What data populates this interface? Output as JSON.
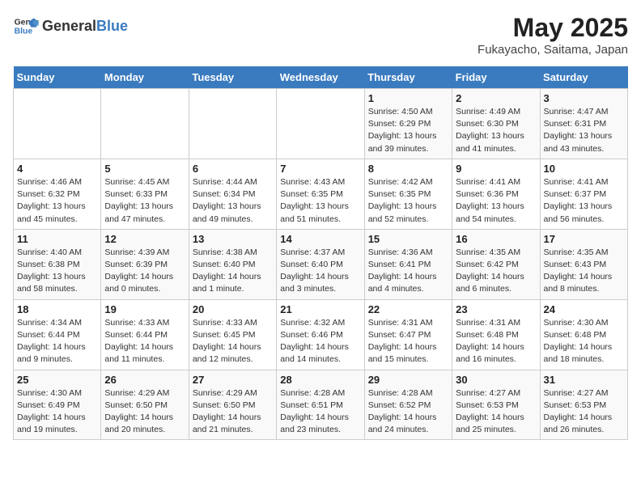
{
  "header": {
    "logo_general": "General",
    "logo_blue": "Blue",
    "title": "May 2025",
    "subtitle": "Fukayacho, Saitama, Japan"
  },
  "calendar": {
    "weekdays": [
      "Sunday",
      "Monday",
      "Tuesday",
      "Wednesday",
      "Thursday",
      "Friday",
      "Saturday"
    ],
    "rows": [
      [
        {
          "day": "",
          "info": ""
        },
        {
          "day": "",
          "info": ""
        },
        {
          "day": "",
          "info": ""
        },
        {
          "day": "",
          "info": ""
        },
        {
          "day": "1",
          "info": "Sunrise: 4:50 AM\nSunset: 6:29 PM\nDaylight: 13 hours\nand 39 minutes."
        },
        {
          "day": "2",
          "info": "Sunrise: 4:49 AM\nSunset: 6:30 PM\nDaylight: 13 hours\nand 41 minutes."
        },
        {
          "day": "3",
          "info": "Sunrise: 4:47 AM\nSunset: 6:31 PM\nDaylight: 13 hours\nand 43 minutes."
        }
      ],
      [
        {
          "day": "4",
          "info": "Sunrise: 4:46 AM\nSunset: 6:32 PM\nDaylight: 13 hours\nand 45 minutes."
        },
        {
          "day": "5",
          "info": "Sunrise: 4:45 AM\nSunset: 6:33 PM\nDaylight: 13 hours\nand 47 minutes."
        },
        {
          "day": "6",
          "info": "Sunrise: 4:44 AM\nSunset: 6:34 PM\nDaylight: 13 hours\nand 49 minutes."
        },
        {
          "day": "7",
          "info": "Sunrise: 4:43 AM\nSunset: 6:35 PM\nDaylight: 13 hours\nand 51 minutes."
        },
        {
          "day": "8",
          "info": "Sunrise: 4:42 AM\nSunset: 6:35 PM\nDaylight: 13 hours\nand 52 minutes."
        },
        {
          "day": "9",
          "info": "Sunrise: 4:41 AM\nSunset: 6:36 PM\nDaylight: 13 hours\nand 54 minutes."
        },
        {
          "day": "10",
          "info": "Sunrise: 4:41 AM\nSunset: 6:37 PM\nDaylight: 13 hours\nand 56 minutes."
        }
      ],
      [
        {
          "day": "11",
          "info": "Sunrise: 4:40 AM\nSunset: 6:38 PM\nDaylight: 13 hours\nand 58 minutes."
        },
        {
          "day": "12",
          "info": "Sunrise: 4:39 AM\nSunset: 6:39 PM\nDaylight: 14 hours\nand 0 minutes."
        },
        {
          "day": "13",
          "info": "Sunrise: 4:38 AM\nSunset: 6:40 PM\nDaylight: 14 hours\nand 1 minute."
        },
        {
          "day": "14",
          "info": "Sunrise: 4:37 AM\nSunset: 6:40 PM\nDaylight: 14 hours\nand 3 minutes."
        },
        {
          "day": "15",
          "info": "Sunrise: 4:36 AM\nSunset: 6:41 PM\nDaylight: 14 hours\nand 4 minutes."
        },
        {
          "day": "16",
          "info": "Sunrise: 4:35 AM\nSunset: 6:42 PM\nDaylight: 14 hours\nand 6 minutes."
        },
        {
          "day": "17",
          "info": "Sunrise: 4:35 AM\nSunset: 6:43 PM\nDaylight: 14 hours\nand 8 minutes."
        }
      ],
      [
        {
          "day": "18",
          "info": "Sunrise: 4:34 AM\nSunset: 6:44 PM\nDaylight: 14 hours\nand 9 minutes."
        },
        {
          "day": "19",
          "info": "Sunrise: 4:33 AM\nSunset: 6:44 PM\nDaylight: 14 hours\nand 11 minutes."
        },
        {
          "day": "20",
          "info": "Sunrise: 4:33 AM\nSunset: 6:45 PM\nDaylight: 14 hours\nand 12 minutes."
        },
        {
          "day": "21",
          "info": "Sunrise: 4:32 AM\nSunset: 6:46 PM\nDaylight: 14 hours\nand 14 minutes."
        },
        {
          "day": "22",
          "info": "Sunrise: 4:31 AM\nSunset: 6:47 PM\nDaylight: 14 hours\nand 15 minutes."
        },
        {
          "day": "23",
          "info": "Sunrise: 4:31 AM\nSunset: 6:48 PM\nDaylight: 14 hours\nand 16 minutes."
        },
        {
          "day": "24",
          "info": "Sunrise: 4:30 AM\nSunset: 6:48 PM\nDaylight: 14 hours\nand 18 minutes."
        }
      ],
      [
        {
          "day": "25",
          "info": "Sunrise: 4:30 AM\nSunset: 6:49 PM\nDaylight: 14 hours\nand 19 minutes."
        },
        {
          "day": "26",
          "info": "Sunrise: 4:29 AM\nSunset: 6:50 PM\nDaylight: 14 hours\nand 20 minutes."
        },
        {
          "day": "27",
          "info": "Sunrise: 4:29 AM\nSunset: 6:50 PM\nDaylight: 14 hours\nand 21 minutes."
        },
        {
          "day": "28",
          "info": "Sunrise: 4:28 AM\nSunset: 6:51 PM\nDaylight: 14 hours\nand 23 minutes."
        },
        {
          "day": "29",
          "info": "Sunrise: 4:28 AM\nSunset: 6:52 PM\nDaylight: 14 hours\nand 24 minutes."
        },
        {
          "day": "30",
          "info": "Sunrise: 4:27 AM\nSunset: 6:53 PM\nDaylight: 14 hours\nand 25 minutes."
        },
        {
          "day": "31",
          "info": "Sunrise: 4:27 AM\nSunset: 6:53 PM\nDaylight: 14 hours\nand 26 minutes."
        }
      ]
    ]
  }
}
